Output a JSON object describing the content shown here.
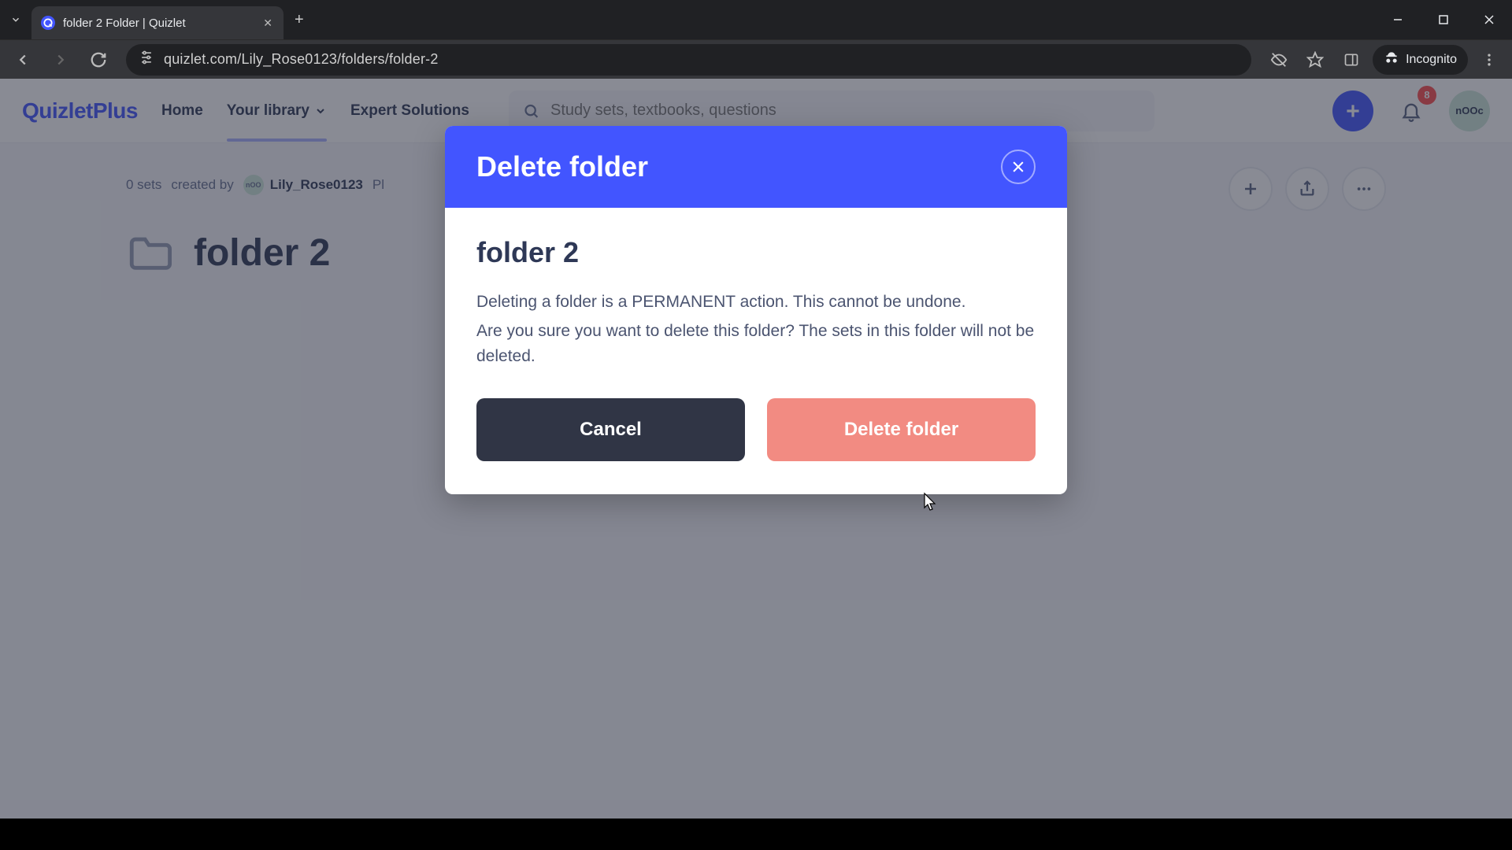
{
  "browser": {
    "tab_title": "folder 2 Folder | Quizlet",
    "url": "quizlet.com/Lily_Rose0123/folders/folder-2",
    "incognito_label": "Incognito"
  },
  "nav": {
    "logo": "QuizletPlus",
    "home": "Home",
    "library": "Your library",
    "expert": "Expert Solutions",
    "search_placeholder": "Study sets, textbooks, questions",
    "badge_count": "8",
    "avatar_text": "nOOc"
  },
  "folder": {
    "set_count": "0 sets",
    "created_by_label": "created by",
    "username": "Lily_Rose0123",
    "plan_prefix": "Pl",
    "name": "folder 2"
  },
  "dialog": {
    "title": "Delete folder",
    "folder_name": "folder 2",
    "line1": "Deleting a folder is a PERMANENT action. This cannot be undone.",
    "line2": "Are you sure you want to delete this folder? The sets in this folder will not be deleted.",
    "cancel": "Cancel",
    "delete": "Delete folder"
  },
  "colors": {
    "accent": "#4255ff",
    "danger": "#f28b82",
    "dark": "#303545"
  }
}
